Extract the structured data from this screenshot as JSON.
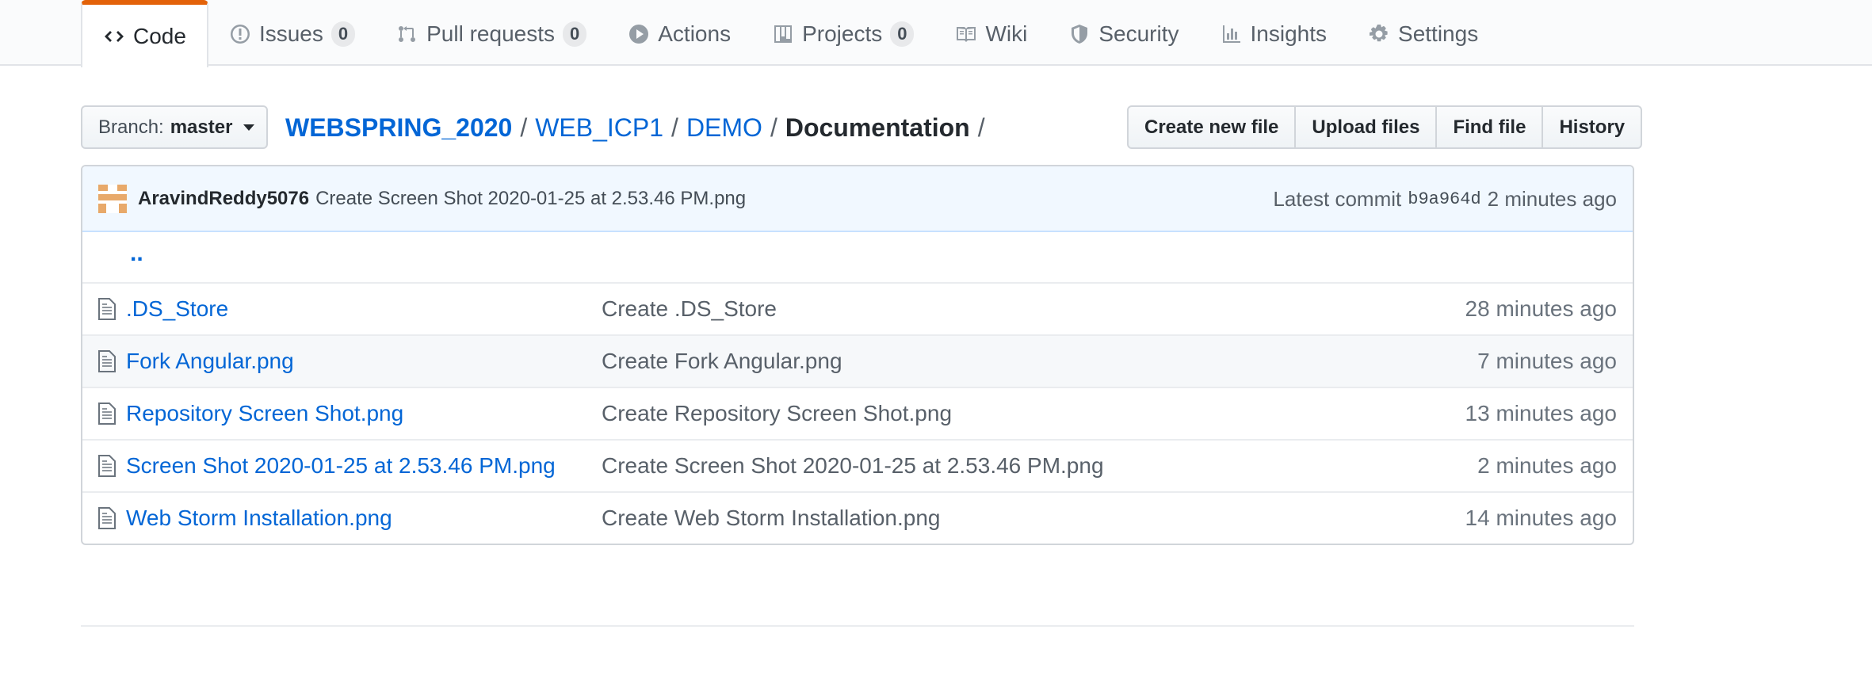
{
  "nav": {
    "items": [
      {
        "label": "Code",
        "icon": "code-icon",
        "selected": true
      },
      {
        "label": "Issues",
        "icon": "issue-icon",
        "count": "0"
      },
      {
        "label": "Pull requests",
        "icon": "pull-request-icon",
        "count": "0"
      },
      {
        "label": "Actions",
        "icon": "play-icon"
      },
      {
        "label": "Projects",
        "icon": "project-icon",
        "count": "0"
      },
      {
        "label": "Wiki",
        "icon": "book-icon"
      },
      {
        "label": "Security",
        "icon": "shield-icon"
      },
      {
        "label": "Insights",
        "icon": "graph-icon"
      },
      {
        "label": "Settings",
        "icon": "gear-icon"
      }
    ]
  },
  "branch": {
    "prefix": "Branch:",
    "name": "master"
  },
  "breadcrumb": {
    "root": "WEBSPRING_2020",
    "parts": [
      "WEB_ICP1",
      "DEMO"
    ],
    "current": "Documentation",
    "separator": "/"
  },
  "actions": {
    "create": "Create new file",
    "upload": "Upload files",
    "find": "Find file",
    "history": "History"
  },
  "commit": {
    "author": "AravindReddy5076",
    "message": "Create Screen Shot 2020-01-25 at 2.53.46 PM.png",
    "latest_label": "Latest commit",
    "sha": "b9a964d",
    "age": "2 minutes ago"
  },
  "files": {
    "up": "..",
    "rows": [
      {
        "name": ".DS_Store",
        "message": "Create .DS_Store",
        "age": "28 minutes ago"
      },
      {
        "name": "Fork Angular.png",
        "message": "Create Fork Angular.png",
        "age": "7 minutes ago"
      },
      {
        "name": "Repository Screen Shot.png",
        "message": "Create Repository Screen Shot.png",
        "age": "13 minutes ago"
      },
      {
        "name": "Screen Shot 2020-01-25 at 2.53.46 PM.png",
        "message": "Create Screen Shot 2020-01-25 at 2.53.46 PM.png",
        "age": "2 minutes ago"
      },
      {
        "name": "Web Storm Installation.png",
        "message": "Create Web Storm Installation.png",
        "age": "14 minutes ago"
      }
    ]
  },
  "colors": {
    "accent_tab": "#e36209",
    "link": "#0366d6",
    "commit_bg": "#f1f8ff",
    "avatar": "#e8a96a"
  }
}
